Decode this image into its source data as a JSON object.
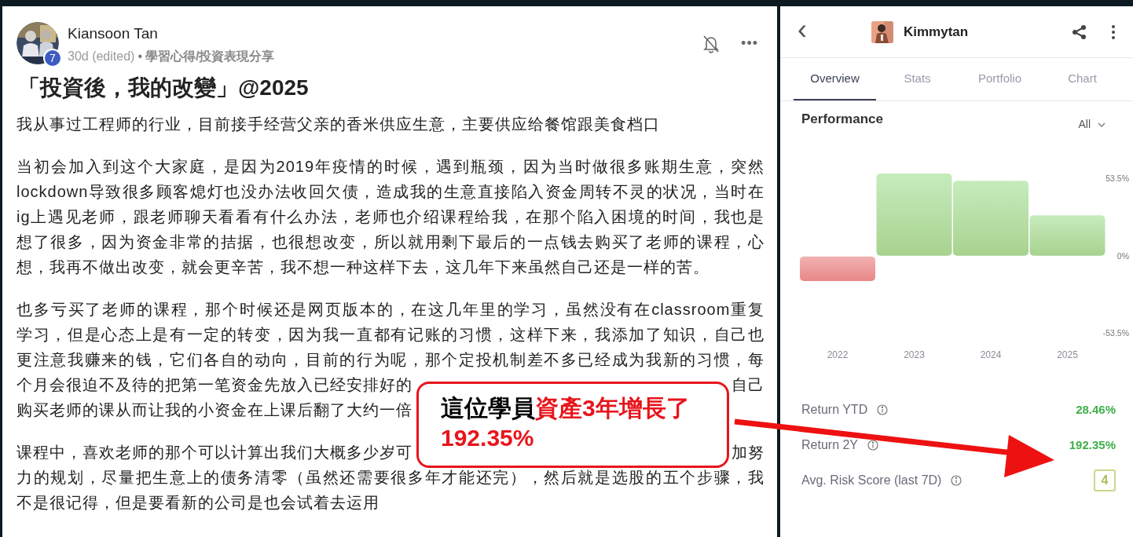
{
  "post": {
    "author": "Kiansoon Tan",
    "badge": "7",
    "time": "30d (edited)",
    "separator": "•",
    "category": "學習心得/投資表現分享",
    "more": "•••",
    "title": "「投資後，我的改變」@2025",
    "paragraphs": [
      {
        "lines": [
          [
            "我从事过工程师的行业，目前接手经营父亲的香米供应生意，主要供应给餐馆跟美食档口"
          ]
        ]
      },
      {
        "lines": [
          [
            "当初会加入到这个大家庭，是因为2019年疫情的时候，遇到瓶颈，因为当时做很多账期生意，突然"
          ],
          [
            "lockdown导致很多顾客熄灯也没办法收回欠债，造成我的生意直接陷入资金周转不灵的状况，当时在"
          ],
          [
            "ig上遇见老师，跟老师聊天看看有什么办法，老师也介绍课程给我，在那个陷入困境的时间，我也是"
          ],
          [
            "想了很多，因为资金非常的拮据，也很想改变，所以就用剩下最后的一点钱去购买了老师的课程，心"
          ],
          [
            "想，我再不做出改变，就会更辛苦，我不想一种这样下去，这几年下来虽然自己还是一样的苦。"
          ]
        ]
      },
      {
        "lines": [
          [
            "也多亏买了老师的课程，那个时候还是网页版本的，在这几年里的学习，虽然没有在classroom重复"
          ],
          [
            "学习，但是心态上是有一定的转变，因为我一直都有记账的习惯，这样下来，我添加了知识，自己也"
          ],
          [
            "更注意我赚来的钱，它们各自的动向，目前的行为呢，那个定投机制差不多已经成为我新的习惯，每"
          ],
          [
            "个月会很迫不及待的把第一笔资金先放入已经安排好的",
            "自己"
          ],
          [
            "购买老师的课从而让我的小资金在上课后翻了大约一倍"
          ]
        ]
      },
      {
        "lines": [
          [
            "课程中，喜欢老师的那个可以计算出我们大概多少岁可",
            "加努"
          ],
          [
            "力的规划，尽量把生意上的债务清零（虽然还需要很多年才能还完），然后就是选股的五个步骤，我"
          ],
          [
            "不是很记得，但是要看新的公司是也会试着去运用"
          ]
        ]
      }
    ]
  },
  "callout": {
    "lines": [
      [
        {
          "text": "這位學員",
          "highlight": false
        },
        {
          "text": "資產3年增長了",
          "highlight": true
        }
      ],
      [
        {
          "text": "192.35%",
          "highlight": true
        }
      ]
    ]
  },
  "profile": {
    "back": "‹",
    "name": "Kimmytan",
    "tabs": [
      {
        "label": "Overview",
        "selected": true
      },
      {
        "label": "Stats",
        "selected": false
      },
      {
        "label": "Portfolio",
        "selected": false
      },
      {
        "label": "Chart",
        "selected": false
      }
    ],
    "section_title": "Performance",
    "period": "All",
    "chart_data": {
      "type": "bar",
      "categories": [
        "2022",
        "2023",
        "2024",
        "2025"
      ],
      "values": [
        -17,
        57,
        52,
        28
      ],
      "ylim": [
        -53.5,
        57
      ],
      "yticks": [
        {
          "value": 53.5,
          "label": "53.5%"
        },
        {
          "value": 0,
          "label": "0%"
        },
        {
          "value": -53.5,
          "label": "-53.5%"
        }
      ]
    },
    "stats": [
      {
        "kind": "return",
        "label": "Return YTD",
        "value": "28.46%"
      },
      {
        "kind": "return",
        "label": "Return 2Y",
        "value": "192.35%"
      },
      {
        "kind": "risk",
        "label": "Avg. Risk Score (last 7D)",
        "value": "4"
      }
    ]
  }
}
